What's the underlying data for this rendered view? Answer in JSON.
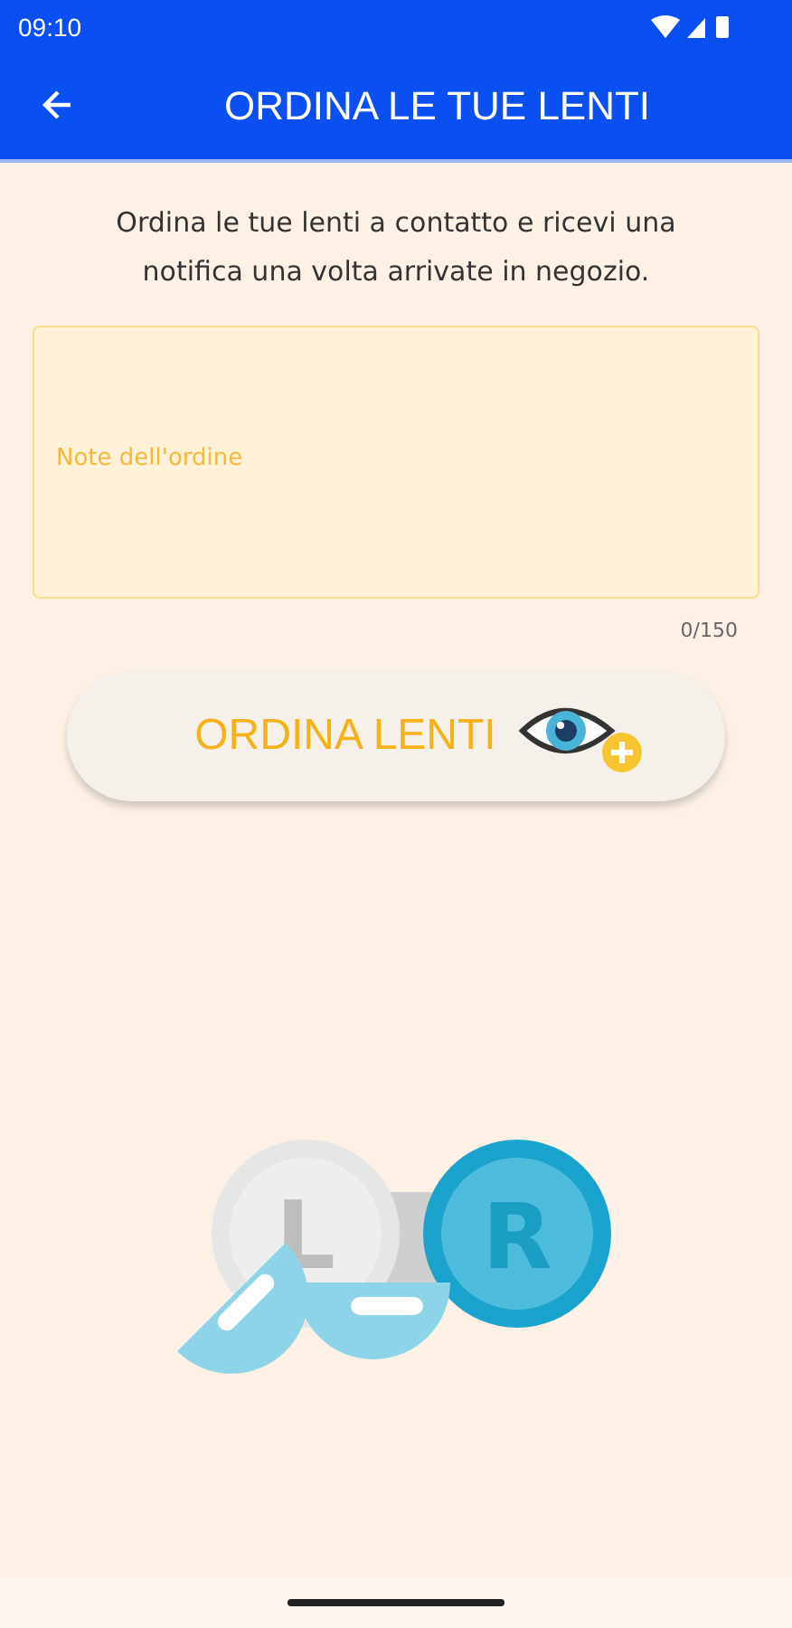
{
  "status_bar": {
    "time": "09:10"
  },
  "app_bar": {
    "title": "ORDINA LE TUE LENTI"
  },
  "description": "Ordina le tue lenti a contatto e ricevi una notifica una volta arrivate in negozio.",
  "notes_field": {
    "placeholder": "Note dell'ordine",
    "counter": "0/150"
  },
  "order_button": {
    "label": "ORDINA LENTI"
  },
  "illustration": {
    "left_label": "L",
    "right_label": "R"
  }
}
